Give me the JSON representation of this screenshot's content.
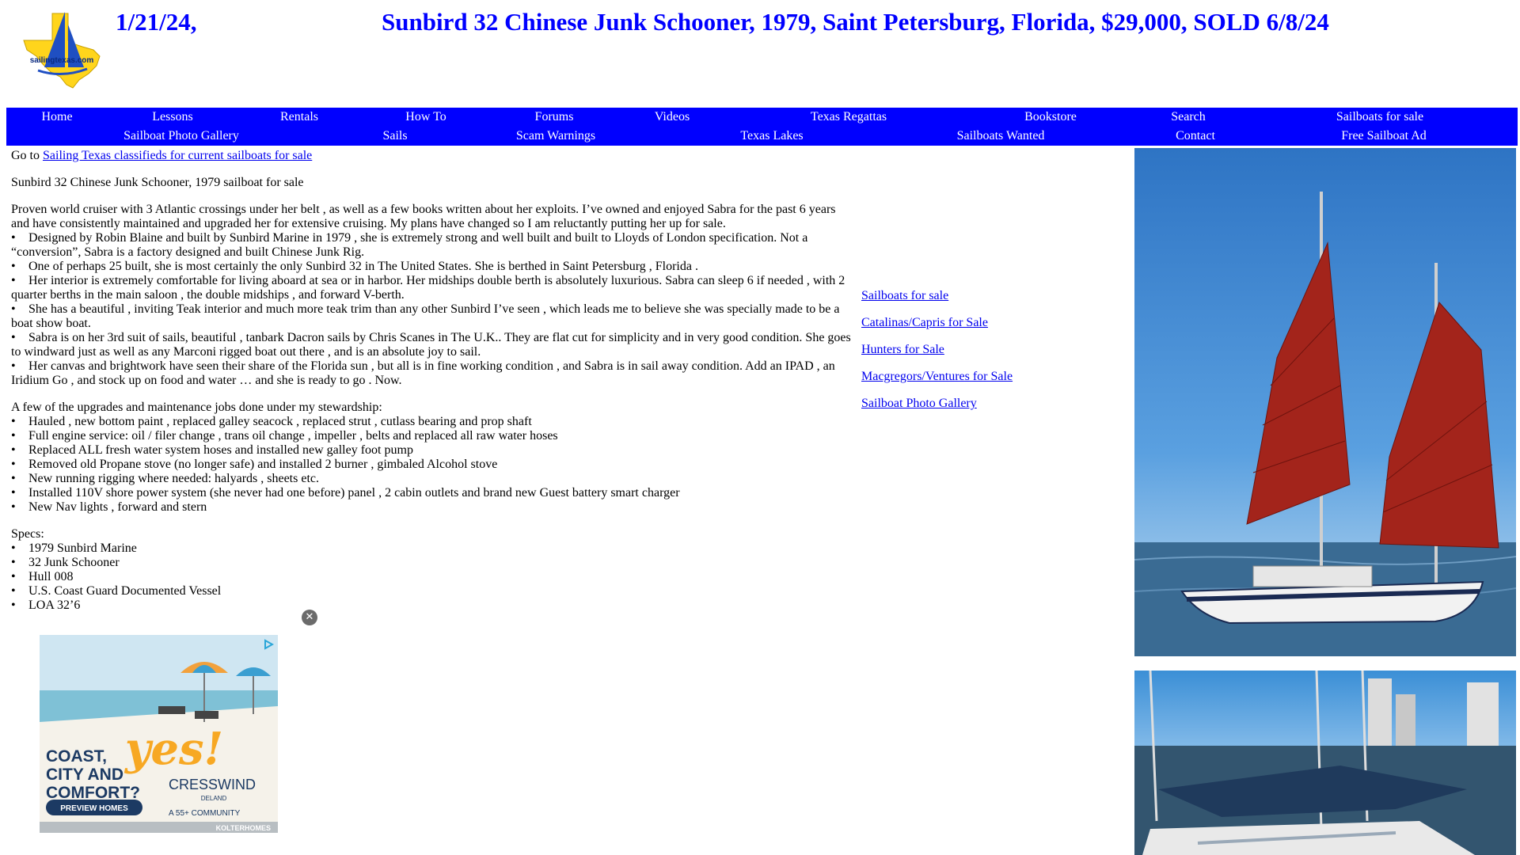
{
  "header": {
    "date": "1/21/24,",
    "title": "Sunbird 32 Chinese Junk Schooner, 1979, Saint Petersburg, Florida, $29,000, SOLD 6/8/24",
    "logo_text": "sailingtexas.com"
  },
  "nav": {
    "row1": [
      "Home",
      "Lessons",
      "Rentals",
      "How To",
      "Forums",
      "Videos",
      "Texas Regattas",
      "Bookstore",
      "Search",
      "Sailboats for sale"
    ],
    "row2": [
      "Sailboat Photo Gallery",
      "Sails",
      "Scam Warnings",
      "Texas Lakes",
      "Sailboats Wanted",
      "Contact",
      "Free Sailboat Ad"
    ]
  },
  "main": {
    "goto_prefix": "Go to ",
    "goto_link": "Sailing Texas classifieds for current sailboats for sale",
    "subtitle": "Sunbird 32 Chinese Junk Schooner, 1979 sailboat for sale",
    "intro": "Proven world cruiser with 3 Atlantic crossings under her belt , as well as a few books written about her exploits. I’ve owned and enjoyed Sabra for the past 6 years and have consistently maintained and upgraded her for extensive cruising. My plans have changed so I am reluctantly putting her up for sale.",
    "bullets": [
      "Designed by Robin Blaine and built by Sunbird Marine in 1979 , she is extremely strong and well built and built to Lloyds of London specification. Not a “conversion”, Sabra is a factory designed and built Chinese Junk Rig.",
      "One of perhaps 25 built, she is most certainly the only Sunbird 32 in The United States. She is berthed in Saint Petersburg , Florida .",
      "Her interior is extremely comfortable for living aboard at sea or in harbor. Her midships double berth is absolutely luxurious. Sabra can sleep 6 if needed , with 2 quarter berths in the main saloon , the double midships , and forward V-berth.",
      "She has a beautiful , inviting Teak interior and much more teak trim than any other Sunbird I’ve seen , which leads me to believe she was specially made to be a boat show boat.",
      "Sabra is on her 3rd suit of sails, beautiful , tanbark Dacron sails by Chris Scanes in The U.K.. They are flat cut for simplicity and in very good condition. She goes to windward just as well as any Marconi rigged boat out there , and is an absolute joy to sail.",
      "Her canvas and brightwork have seen their share of the Florida sun , but all is in fine working condition , and Sabra is in sail away condition. Add an IPAD , an Iridium Go , and stock up on food and water … and she is ready to go . Now."
    ],
    "upgrades_heading": "A few of the upgrades and maintenance jobs done under my stewardship:",
    "upgrades": [
      "Hauled , new bottom paint , replaced galley seacock , replaced strut , cutlass bearing and prop shaft",
      "Full engine service: oil / filer change , trans oil change , impeller , belts and replaced all raw water hoses",
      "Replaced ALL fresh water system hoses and installed new galley foot pump",
      "Removed old Propane stove (no longer safe) and installed 2 burner , gimbaled Alcohol stove",
      "New running rigging where needed: halyards , sheets etc.",
      "Installed 110V shore power system (she never had one before) panel , 2 cabin outlets and brand new Guest battery smart charger",
      "New Nav lights , forward and stern"
    ],
    "specs_heading": "Specs:",
    "specs": [
      "1979 Sunbird Marine",
      "32 Junk Schooner",
      "Hull 008",
      "U.S. Coast Guard Documented Vessel",
      "LOA 32’6"
    ]
  },
  "side_links": [
    "Sailboats for sale",
    "Catalinas/Capris for Sale",
    "Hunters for Sale",
    "Macgregors/Ventures for Sale",
    "Sailboat Photo Gallery"
  ],
  "ad": {
    "headline": "COAST, CITY AND COMFORT?",
    "yes": "yes!",
    "brand": "CRESSWIND",
    "brand_sub": "DELAND",
    "community": "A 55+ COMMUNITY",
    "cta": "PREVIEW HOMES",
    "builder": "KOLTERHOMES",
    "close_icon": "✕"
  },
  "colors": {
    "nav_bg": "#0000ff",
    "title_blue": "#0000ff",
    "link": "#0000ee",
    "ad_orange": "#f7a823",
    "ad_navy": "#1c3a63",
    "sail_red": "#a3241b"
  }
}
